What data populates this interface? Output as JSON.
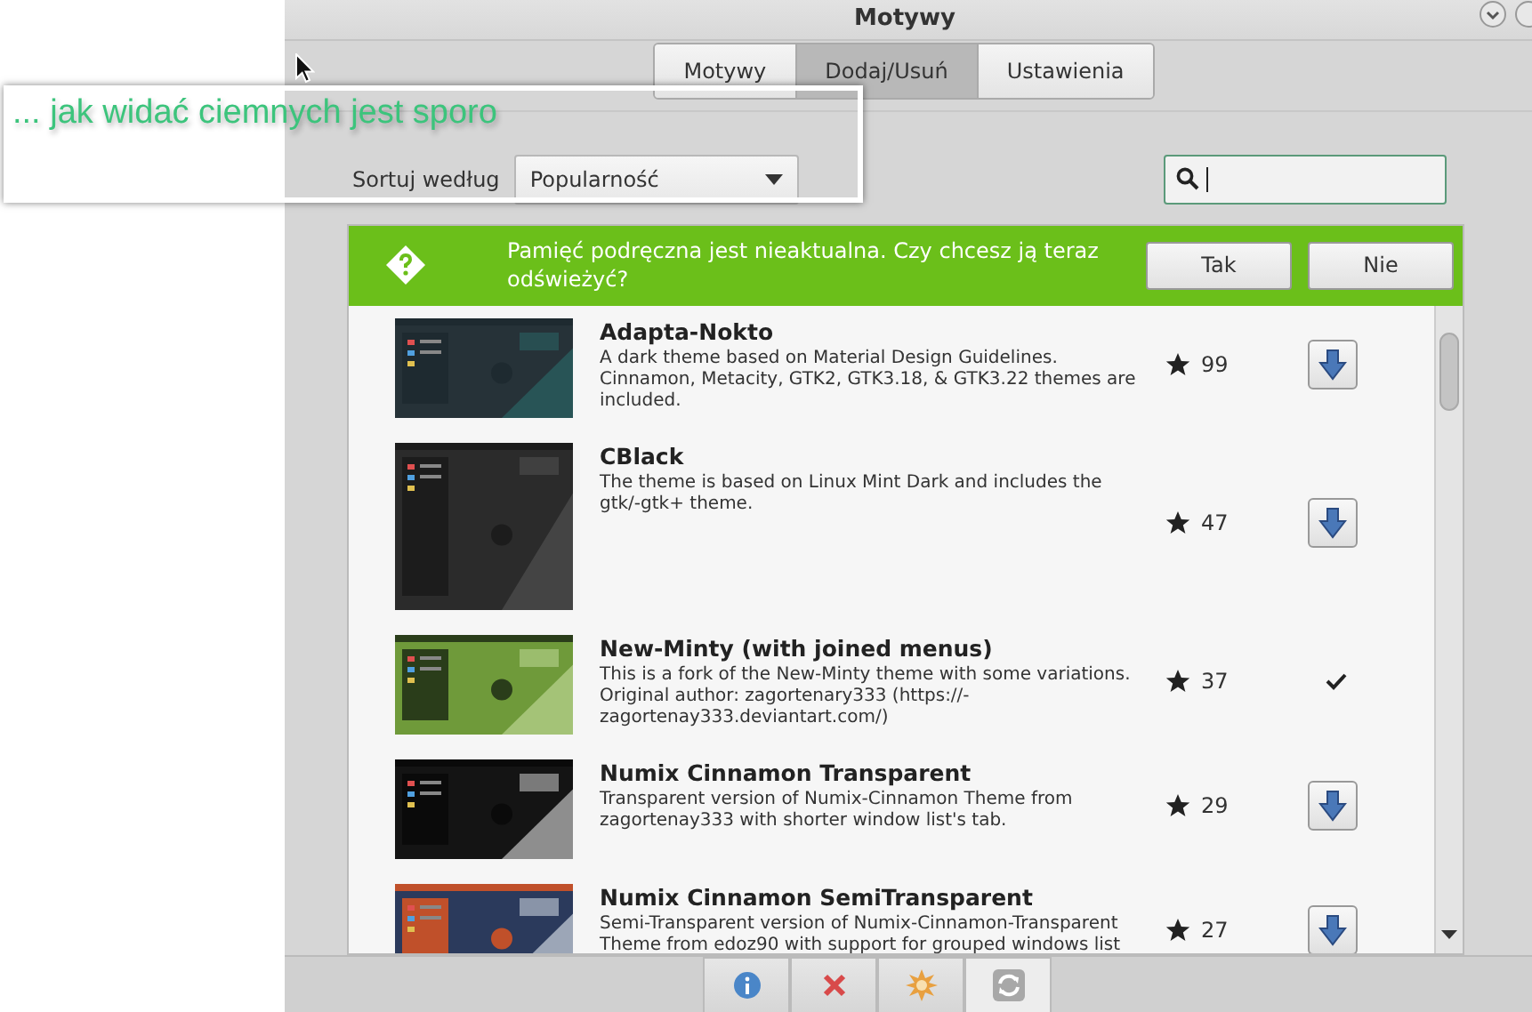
{
  "window": {
    "title": "Motywy"
  },
  "tabs": [
    {
      "label": "Motywy",
      "selected": false
    },
    {
      "label": "Dodaj/Usuń",
      "selected": true
    },
    {
      "label": "Ustawienia",
      "selected": false
    }
  ],
  "sort": {
    "label": "Sortuj według",
    "value": "Popularność"
  },
  "infobar": {
    "message": "Pamięć podręczna jest nieaktualna. Czy chcesz ją teraz odświeżyć?",
    "buttons": [
      "Tak",
      "Nie"
    ]
  },
  "themes": [
    {
      "name": "Adapta-Nokto",
      "description": "A dark theme based on Material Design Guidelines. Cinnamon, Metacity, GTK2, GTK3.18, & GTK3.22 themes are included.",
      "rating": "99",
      "installed": false
    },
    {
      "name": "CBlack",
      "description": "The theme is based on Linux Mint Dark and includes the gtk/-gtk+ theme.",
      "rating": "47",
      "installed": false
    },
    {
      "name": "New-Minty (with joined menus)",
      "description": "This is a fork of the New-Minty theme with some variations. Original author: zagortenary333 (https://-zagortenay333.deviantart.com/)",
      "rating": "37",
      "installed": true
    },
    {
      "name": "Numix Cinnamon Transparent",
      "description": "Transparent version of Numix-Cinnamon Theme from zagortenay333 with shorter window list's tab.",
      "rating": "29",
      "installed": false
    },
    {
      "name": "Numix Cinnamon SemiTransparent",
      "description": "Semi-Transparent version of Numix-Cinnamon-Transparent Theme from edoz90 with support for grouped windows list",
      "rating": "27",
      "installed": false
    }
  ],
  "annotation": {
    "text": "... jak widać ciemnych jest sporo"
  }
}
